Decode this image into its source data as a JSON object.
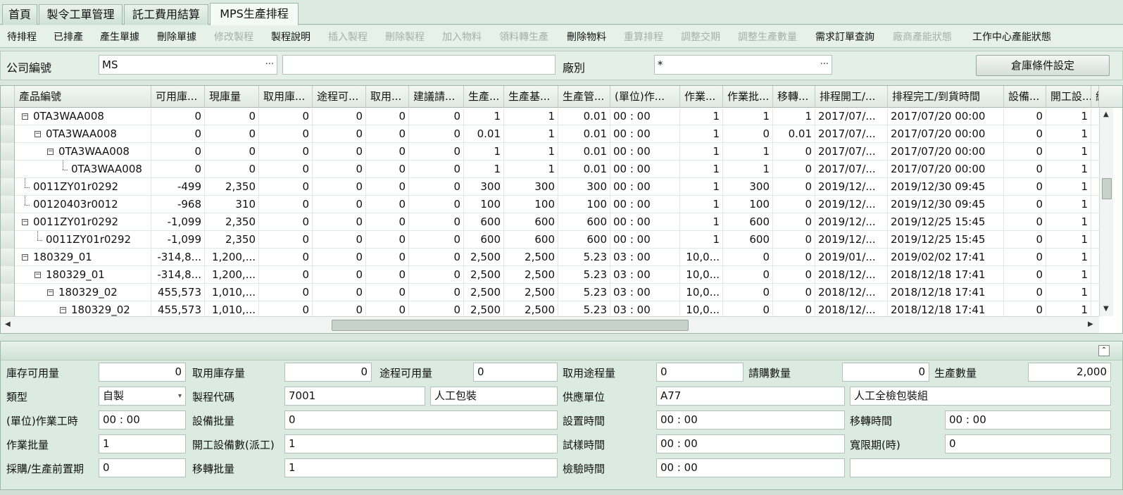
{
  "tabs": [
    {
      "label": "首頁"
    },
    {
      "label": "製令工單管理"
    },
    {
      "label": "託工費用結算"
    },
    {
      "label": "MPS生產排程"
    }
  ],
  "toolbar": [
    {
      "label": "待排程",
      "enabled": true
    },
    {
      "label": "已排產",
      "enabled": true
    },
    {
      "label": "產生單據",
      "enabled": true
    },
    {
      "label": "刪除單據",
      "enabled": true
    },
    {
      "label": "修改製程",
      "enabled": false
    },
    {
      "label": "製程說明",
      "enabled": true
    },
    {
      "label": "插入製程",
      "enabled": false
    },
    {
      "label": "刪除製程",
      "enabled": false
    },
    {
      "label": "加入物料",
      "enabled": false
    },
    {
      "label": "領料轉生產",
      "enabled": false
    },
    {
      "label": "刪除物料",
      "enabled": true
    },
    {
      "label": "重算排程",
      "enabled": false
    },
    {
      "label": "調整交期",
      "enabled": false
    },
    {
      "label": "調整生產數量",
      "enabled": false
    },
    {
      "label": "需求訂單查詢",
      "enabled": true
    },
    {
      "label": "廠商產能狀態",
      "enabled": false
    },
    {
      "label": "工作中心產能狀態",
      "enabled": true
    }
  ],
  "filter": {
    "company_label": "公司編號",
    "company_value": "MS",
    "company_name_value": "",
    "factory_label": "廠別",
    "factory_value": "*",
    "ellipsis": "···",
    "settings_button": "倉庫條件設定"
  },
  "grid": {
    "columns": [
      "產品編號",
      "可用庫...",
      "現庫量",
      "取用庫...",
      "途程可...",
      "取用...",
      "建議請...",
      "生產...",
      "生產基...",
      "生產管...",
      "(單位)作...",
      "作業...",
      "作業批...",
      "移轉...",
      "排程開工/...",
      "排程完工/到貨時間",
      "設備...",
      "開工設...",
      "總"
    ],
    "rows": [
      {
        "level": 0,
        "toggle": "−",
        "cells": [
          "0TA3WAA008",
          "0",
          "0",
          "0",
          "0",
          "0",
          "0",
          "1",
          "1",
          "0.01",
          "00 : 00",
          "1",
          "1",
          "1",
          "2017/07/...",
          "2017/07/20 00:00",
          "0",
          "1"
        ]
      },
      {
        "level": 1,
        "toggle": "−",
        "cells": [
          "0TA3WAA008",
          "0",
          "0",
          "0",
          "0",
          "0",
          "0",
          "0.01",
          "1",
          "0.01",
          "00 : 00",
          "1",
          "0",
          "0.01",
          "2017/07/...",
          "2017/07/20 00:00",
          "0",
          "1"
        ]
      },
      {
        "level": 2,
        "toggle": "−",
        "cells": [
          "0TA3WAA008",
          "0",
          "0",
          "0",
          "0",
          "0",
          "0",
          "1",
          "1",
          "0.01",
          "00 : 00",
          "1",
          "1",
          "0",
          "2017/07/...",
          "2017/07/20 00:00",
          "0",
          "1"
        ]
      },
      {
        "level": 3,
        "toggle": "",
        "cells": [
          "0TA3WAA008",
          "0",
          "0",
          "0",
          "0",
          "0",
          "0",
          "1",
          "1",
          "0.01",
          "00 : 00",
          "1",
          "1",
          "0",
          "2017/07/...",
          "2017/07/20 00:00",
          "0",
          "1"
        ]
      },
      {
        "level": 0,
        "toggle": "",
        "cells": [
          "0011ZY01r0292",
          "-499",
          "2,350",
          "0",
          "0",
          "0",
          "0",
          "300",
          "300",
          "300",
          "00 : 00",
          "1",
          "300",
          "0",
          "2019/12/...",
          "2019/12/30 09:45",
          "0",
          "1"
        ]
      },
      {
        "level": 0,
        "toggle": "",
        "cells": [
          "00120403r0012",
          "-968",
          "310",
          "0",
          "0",
          "0",
          "0",
          "100",
          "100",
          "100",
          "00 : 00",
          "1",
          "100",
          "0",
          "2019/12/...",
          "2019/12/30 09:45",
          "0",
          "1"
        ]
      },
      {
        "level": 0,
        "toggle": "−",
        "cells": [
          "0011ZY01r0292",
          "-1,099",
          "2,350",
          "0",
          "0",
          "0",
          "0",
          "600",
          "600",
          "600",
          "00 : 00",
          "1",
          "600",
          "0",
          "2019/12/...",
          "2019/12/25 15:45",
          "0",
          "1"
        ]
      },
      {
        "level": 1,
        "toggle": "",
        "cells": [
          "0011ZY01r0292",
          "-1,099",
          "2,350",
          "0",
          "0",
          "0",
          "0",
          "600",
          "600",
          "600",
          "00 : 00",
          "1",
          "600",
          "0",
          "2019/12/...",
          "2019/12/25 15:45",
          "0",
          "1"
        ]
      },
      {
        "level": 0,
        "toggle": "−",
        "cells": [
          "180329_01",
          "-314,8...",
          "1,200,...",
          "0",
          "0",
          "0",
          "0",
          "2,500",
          "2,500",
          "5.23",
          "03 : 00",
          "10,0...",
          "0",
          "0",
          "2019/01/...",
          "2019/02/02 17:41",
          "0",
          "1"
        ]
      },
      {
        "level": 1,
        "toggle": "−",
        "cells": [
          "180329_01",
          "-314,8...",
          "1,200,...",
          "0",
          "0",
          "0",
          "0",
          "2,500",
          "2,500",
          "5.23",
          "03 : 00",
          "10,0...",
          "0",
          "0",
          "2018/12/...",
          "2018/12/18 17:41",
          "0",
          "1"
        ]
      },
      {
        "level": 2,
        "toggle": "−",
        "cells": [
          "180329_02",
          "455,573",
          "1,010,...",
          "0",
          "0",
          "0",
          "0",
          "2,500",
          "2,500",
          "5.23",
          "03 : 00",
          "10,0...",
          "0",
          "0",
          "2018/12/...",
          "2018/12/18 17:41",
          "0",
          "1"
        ]
      },
      {
        "level": 3,
        "toggle": "−",
        "cells": [
          "180329_02",
          "455,573",
          "1,010,...",
          "0",
          "0",
          "0",
          "0",
          "2,500",
          "2,500",
          "5.23",
          "03 : 00",
          "10,0...",
          "0",
          "0",
          "2018/12/...",
          "2018/12/18 17:41",
          "0",
          "1"
        ]
      }
    ]
  },
  "detail": {
    "collapse_glyph": "⌃",
    "fields": [
      {
        "label": "庫存可用量",
        "value": "0",
        "align": "r"
      },
      {
        "label": "取用庫存量",
        "value": "0",
        "align": "r"
      },
      {
        "label": "途程可用量",
        "value": "0",
        "align": "l"
      },
      {
        "label": "取用途程量",
        "value": "0",
        "align": "l"
      },
      {
        "label": "請購數量",
        "value": "0",
        "align": "r"
      },
      {
        "label": "生產數量",
        "value": "2,000",
        "align": "r"
      },
      {
        "label": "類型",
        "value": "自製"
      },
      {
        "label": "製程代碼",
        "value": "7001",
        "extra": "人工包裝"
      },
      {
        "label": "供應單位",
        "value": "A77",
        "extra": "人工全檢包裝組"
      },
      {
        "label": "(單位)作業工時",
        "value": "00 : 00"
      },
      {
        "label": "設備批量",
        "value": "0"
      },
      {
        "label": "設置時間",
        "value": "00 : 00"
      },
      {
        "label": "移轉時間",
        "value": "00 : 00"
      },
      {
        "label": "作業批量",
        "value": "1"
      },
      {
        "label": "開工設備數(派工)",
        "value": "1"
      },
      {
        "label": "試樣時間",
        "value": "00 : 00"
      },
      {
        "label": "寬限期(時)",
        "value": "0"
      },
      {
        "label": "採購/生產前置期",
        "value": "0"
      },
      {
        "label": "移轉批量",
        "value": "1"
      },
      {
        "label": "檢驗時間",
        "value": "00 : 00"
      },
      {
        "label": "",
        "value": ""
      }
    ]
  }
}
